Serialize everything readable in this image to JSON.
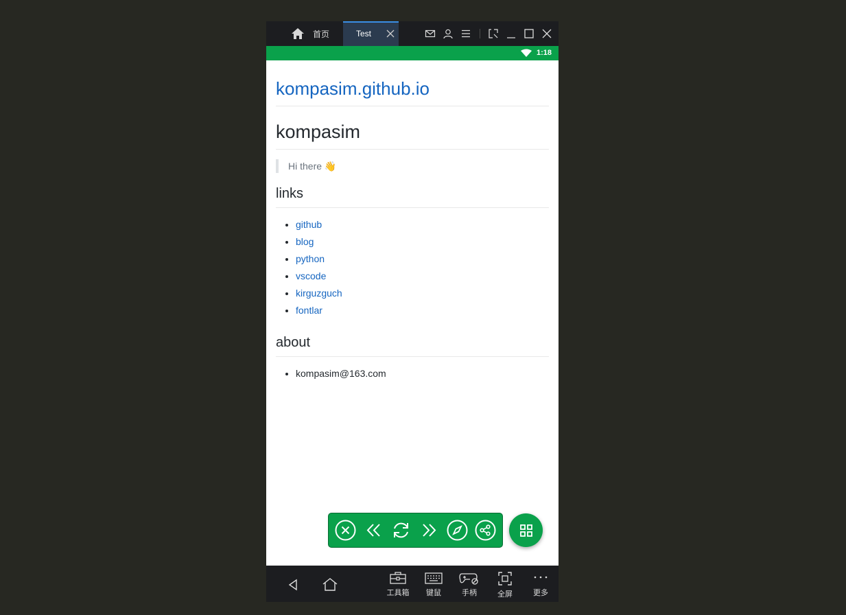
{
  "titlebar": {
    "home_tab": "首页",
    "active_tab": "Test"
  },
  "statusbar": {
    "time": "1:18"
  },
  "page": {
    "site_title": "kompasim.github.io",
    "heading": "kompasim",
    "quote": "Hi there 👋",
    "links_heading": "links",
    "links": [
      "github",
      "blog",
      "python",
      "vscode",
      "kirguzguch",
      "fontlar"
    ],
    "about_heading": "about",
    "about_items": [
      "kompasim@163.com"
    ]
  },
  "bottom_bar": {
    "toolbox": "工具箱",
    "keymouse": "键鼠",
    "gamepad": "手柄",
    "fullscreen": "全屏",
    "more": "更多"
  },
  "colors": {
    "accent_green": "#0aa14b",
    "link_blue": "#1565c0",
    "titlebar_bg": "#1c1d20",
    "desktop_bg": "#272822"
  }
}
